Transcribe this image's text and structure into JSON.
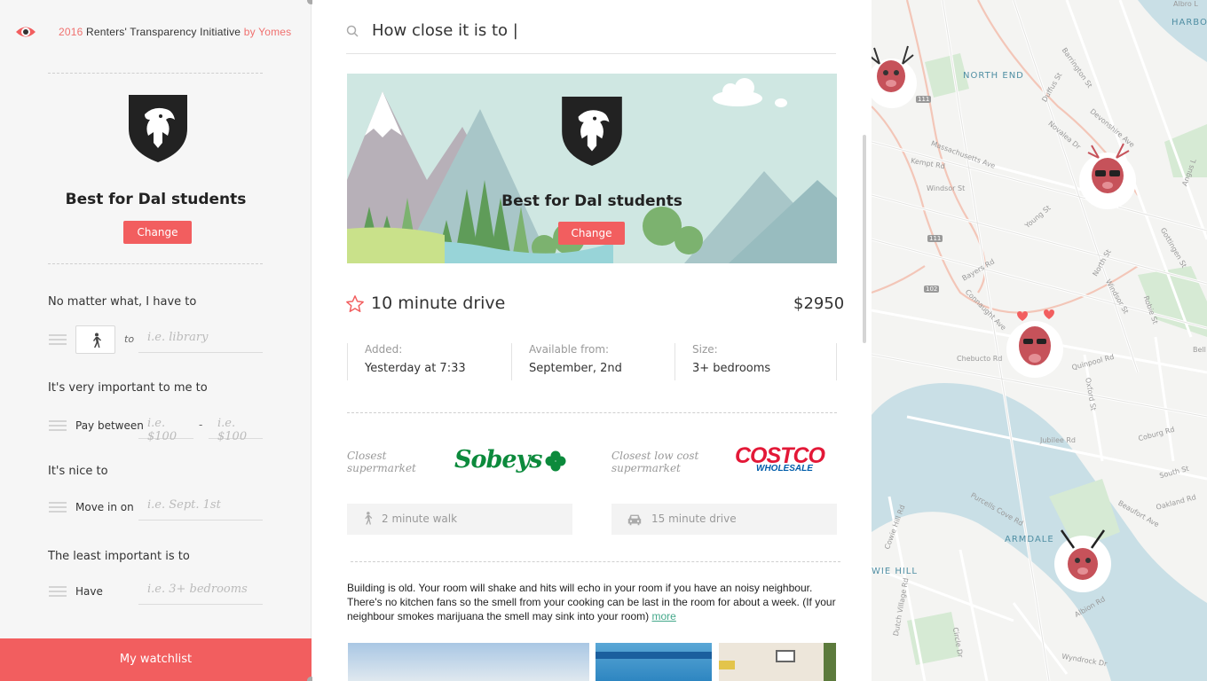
{
  "header": {
    "year": "2016",
    "initiative": "Renters' Transparency Initiative",
    "by": "by Yomes"
  },
  "profile": {
    "title": "Best for Dal students",
    "change_label": "Change"
  },
  "preferences": {
    "must": {
      "heading": "No matter what, I have to",
      "to_label": "to",
      "placeholder": "i.e. library"
    },
    "important": {
      "heading": "It's very important to me to",
      "label": "Pay between",
      "min_placeholder": "i.e. $100",
      "separator": "-",
      "max_placeholder": "i.e. $100"
    },
    "nice": {
      "heading": "It's nice to",
      "label": "Move in on",
      "placeholder": "i.e. Sept. 1st"
    },
    "least": {
      "heading": "The least important is to",
      "label": "Have",
      "placeholder": "i.e. 3+ bedrooms"
    }
  },
  "watchlist_label": "My watchlist",
  "search": {
    "value": "How close it is to |"
  },
  "hero": {
    "title": "Best for Dal students",
    "change_label": "Change"
  },
  "listing": {
    "commute": "10 minute drive",
    "price": "$2950",
    "details": [
      {
        "key": "Added:",
        "value": "Yesterday at 7:33"
      },
      {
        "key": "Available from:",
        "value": "September, 2nd"
      },
      {
        "key": "Size:",
        "value": "3+ bedrooms"
      }
    ],
    "stores": [
      {
        "label_line1": "Closest",
        "label_line2": "supermarket",
        "brand": "Sobeys",
        "distance": "2 minute walk",
        "mode_icon": "walk-icon"
      },
      {
        "label_line1": "Closest low cost",
        "label_line2": "supermarket",
        "brand": "COSTCO",
        "brand_sub": "WHOLESALE",
        "distance": "15 minute drive",
        "mode_icon": "car-icon"
      }
    ],
    "description": "Building is old. Your room will shake and hits will echo in your room if you have an noisy neighbour. There's no kitchen fans so the smell from your cooking can be last in the room for about a week. (If your neighbour smokes marijuana the smell may sink into your room)",
    "more_label": "more"
  },
  "map": {
    "labels": [
      {
        "text": "NORTH END",
        "kind": "area"
      },
      {
        "text": "ARMDALE",
        "kind": "area"
      },
      {
        "text": "WIE HILL",
        "kind": "area"
      },
      {
        "text": "HARBO",
        "kind": "area"
      },
      {
        "text": "Albro L",
        "kind": "street"
      },
      {
        "text": "Barrington St",
        "kind": "street"
      },
      {
        "text": "Duffus St",
        "kind": "street"
      },
      {
        "text": "Novalea Dr",
        "kind": "street"
      },
      {
        "text": "Devonshire Ave",
        "kind": "street"
      },
      {
        "text": "Massachusetts Ave",
        "kind": "street"
      },
      {
        "text": "Kempt Rd",
        "kind": "street"
      },
      {
        "text": "Windsor St",
        "kind": "street"
      },
      {
        "text": "Young St",
        "kind": "street"
      },
      {
        "text": "Gottingen St",
        "kind": "street"
      },
      {
        "text": "North St",
        "kind": "street"
      },
      {
        "text": "Bayers Rd",
        "kind": "street"
      },
      {
        "text": "Connaught Ave",
        "kind": "street"
      },
      {
        "text": "Chebucto Rd",
        "kind": "street"
      },
      {
        "text": "Windsor St",
        "kind": "street"
      },
      {
        "text": "Robie St",
        "kind": "street"
      },
      {
        "text": "Quinpool Rd",
        "kind": "street"
      },
      {
        "text": "Oxford St",
        "kind": "street"
      },
      {
        "text": "Jubilee Rd",
        "kind": "street"
      },
      {
        "text": "Coburg Rd",
        "kind": "street"
      },
      {
        "text": "South St",
        "kind": "street"
      },
      {
        "text": "Purcells Cove Rd",
        "kind": "street"
      },
      {
        "text": "Beaufort Ave",
        "kind": "street"
      },
      {
        "text": "Oakland Rd",
        "kind": "street"
      },
      {
        "text": "Bell",
        "kind": "street"
      },
      {
        "text": "Angus L",
        "kind": "street"
      },
      {
        "text": "Cowie Hill Rd",
        "kind": "street"
      },
      {
        "text": "Dutch Village Rd",
        "kind": "street"
      },
      {
        "text": "Wyndrock Dr",
        "kind": "street"
      },
      {
        "text": "Albion Rd",
        "kind": "street"
      },
      {
        "text": "Circle Dr",
        "kind": "street"
      }
    ],
    "shields": [
      "111",
      "111",
      "102"
    ]
  },
  "colors": {
    "accent": "#f25e5f",
    "accent_text": "#f0716f",
    "link": "#43a88a",
    "map_water": "#c9dfe6",
    "map_park": "#d6ead4"
  }
}
